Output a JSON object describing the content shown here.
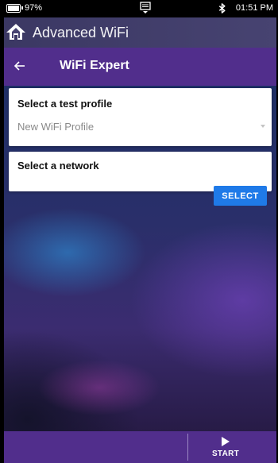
{
  "status_bar": {
    "battery_percent": "97%",
    "time": "01:51 PM",
    "icons": [
      "battery-icon",
      "notification-icon",
      "bluetooth-icon"
    ]
  },
  "app_header": {
    "title": "Advanced WiFi",
    "icon": "home-icon"
  },
  "sub_header": {
    "title": "WiFi Expert",
    "back_icon": "back-arrow-icon"
  },
  "test_profile_card": {
    "title": "Select a test profile",
    "selected_value": "New WiFi Profile"
  },
  "network_card": {
    "title": "Select a network",
    "button_label": "SELECT"
  },
  "bottom_bar": {
    "start_label": "START",
    "start_icon": "play-icon"
  },
  "colors": {
    "header_purple": "#512e8c",
    "select_blue": "#1f7ae8"
  }
}
